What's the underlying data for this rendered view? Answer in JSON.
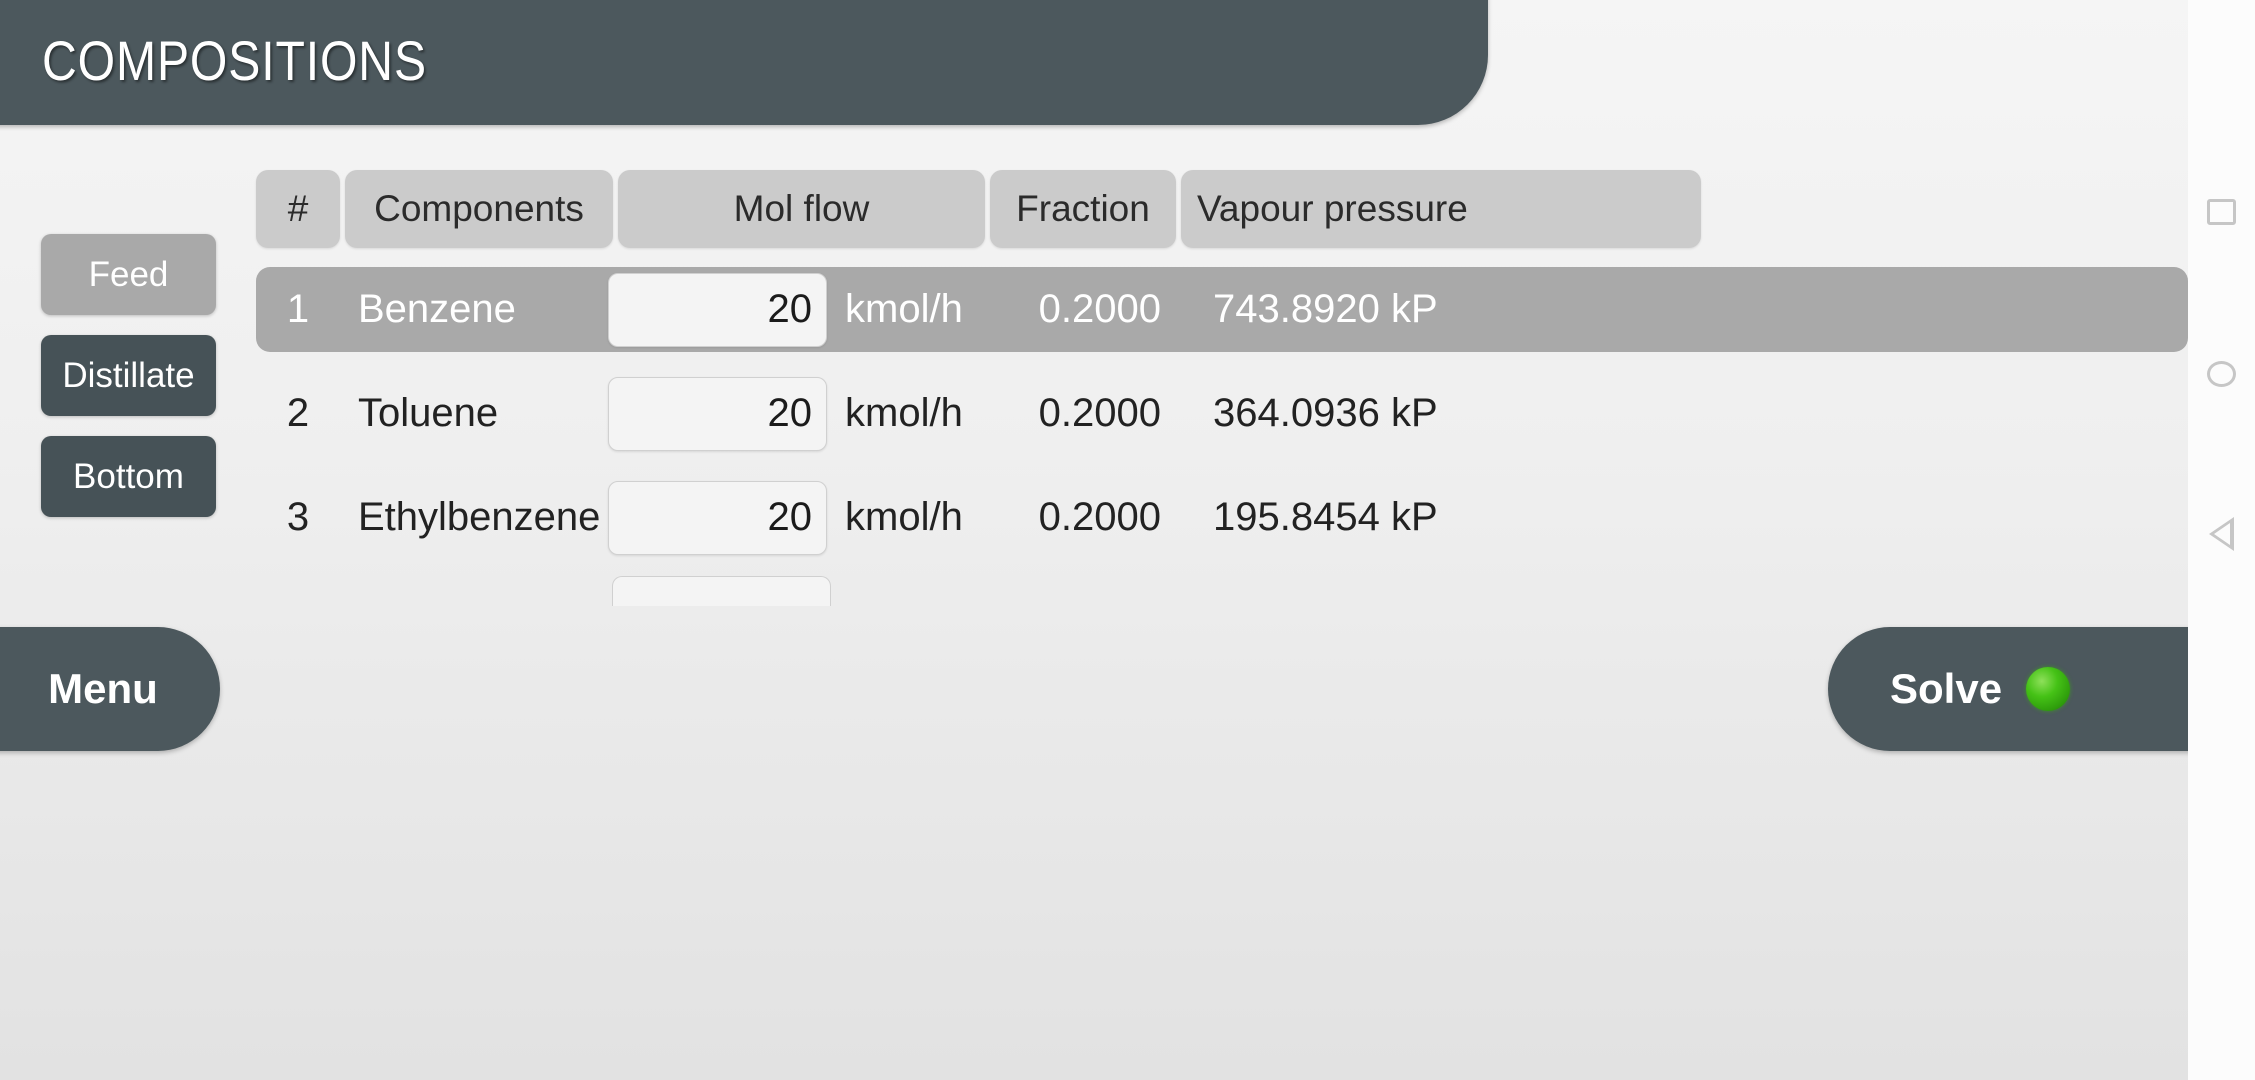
{
  "header": {
    "title": "COMPOSITIONS"
  },
  "stream_selector": {
    "items": [
      {
        "label": "Feed",
        "state": "active"
      },
      {
        "label": "Distillate",
        "state": "inactive"
      },
      {
        "label": "Bottom",
        "state": "inactive"
      }
    ]
  },
  "table": {
    "columns": [
      "#",
      "Components",
      "Mol flow",
      "Fraction",
      "Vapour pressure"
    ],
    "rows": [
      {
        "index": "1",
        "component": "Benzene",
        "mol_flow": "20",
        "mol_flow_unit": "kmol/h",
        "fraction": "0.2000",
        "vapour_pressure": "743.8920 kP",
        "selected": true
      },
      {
        "index": "2",
        "component": "Toluene",
        "mol_flow": "20",
        "mol_flow_unit": "kmol/h",
        "fraction": "0.2000",
        "vapour_pressure": "364.0936 kP",
        "selected": false
      },
      {
        "index": "3",
        "component": "Ethylbenzene",
        "mol_flow": "20",
        "mol_flow_unit": "kmol/h",
        "fraction": "0.2000",
        "vapour_pressure": "195.8454 kP",
        "selected": false
      }
    ]
  },
  "bottom_bar": {
    "menu_label": "Menu",
    "solve_label": "Solve",
    "solve_indicator": "green-led"
  },
  "navigation_bar": {
    "buttons": [
      {
        "name": "recents-icon",
        "glyph": "square"
      },
      {
        "name": "home-icon",
        "glyph": "circle"
      },
      {
        "name": "back-icon",
        "glyph": "triangle-left"
      }
    ]
  },
  "colors": {
    "header_bg": "#4c585d",
    "selected_row": "#a9a9a9",
    "table_header_bg": "#cbcbcb",
    "accent_led": "#45c216",
    "page_bg": "#efefef"
  }
}
